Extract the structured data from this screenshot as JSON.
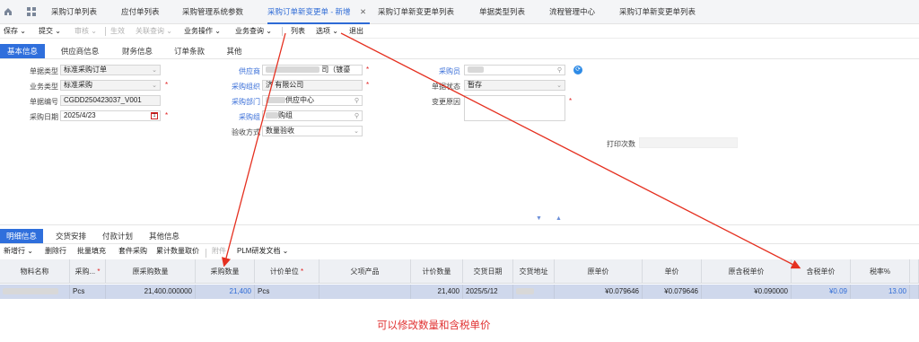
{
  "tabs": [
    {
      "label": "采购订单列表"
    },
    {
      "label": "应付单列表"
    },
    {
      "label": "采购管理系统参数"
    },
    {
      "label": "采购订单新变更单 - 新增"
    },
    {
      "label": "采购订单新变更单列表"
    },
    {
      "label": "单据类型列表"
    },
    {
      "label": "流程管理中心"
    },
    {
      "label": "采购订单新变更单列表"
    }
  ],
  "toolbar": {
    "save": "保存",
    "submit": "提交",
    "audit": "审核",
    "effect": "生效",
    "link_query": "关联查询",
    "biz_op": "业务操作",
    "biz_query": "业务查询",
    "list": "列表",
    "options": "选项",
    "exit": "退出"
  },
  "section_tabs": [
    "基本信息",
    "供应商信息",
    "财务信息",
    "订单条款",
    "其他"
  ],
  "form": {
    "doc_type": {
      "label": "单据类型",
      "value": "标准采购订单"
    },
    "biz_type": {
      "label": "业务类型",
      "value": "标准采购"
    },
    "doc_no": {
      "label": "单据编号",
      "value": "CGDD250423037_V001"
    },
    "purchase_date": {
      "label": "采购日期",
      "value": "2025/4/23"
    },
    "supplier": {
      "label": "供应商",
      "value": "司（镀鎏"
    },
    "purchase_org": {
      "label": "采购组织",
      "value": "济          有限公司"
    },
    "purchase_dept": {
      "label": "采购部门",
      "value": "供应中心"
    },
    "purchase_group": {
      "label": "采购组",
      "value": "购组"
    },
    "inspect": {
      "label": "验收方式",
      "value": "数量验收"
    },
    "buyer": {
      "label": "采购员",
      "value": ""
    },
    "doc_status": {
      "label": "单据状态",
      "value": "暂存"
    },
    "change_reason": {
      "label": "变更原因",
      "value": ""
    },
    "print_count": {
      "label": "打印次数",
      "value": ""
    }
  },
  "detail_tabs": [
    "明细信息",
    "交货安排",
    "付款计划",
    "其他信息"
  ],
  "detail_toolbar": [
    "新增行",
    "删除行",
    "批量填充",
    "套件采购",
    "累计数量取价",
    "附件",
    "PLM研发文档"
  ],
  "grid": {
    "headers": [
      "物料名称",
      "采购...",
      "原采购数量",
      "采购数量",
      "计价单位",
      "父项产品",
      "计价数量",
      "交货日期",
      "交货地址",
      "原单价",
      "单价",
      "原含税单价",
      "含税单价",
      "税率%"
    ],
    "row": [
      "",
      "Pcs",
      "21,400.000000",
      "21,400",
      "Pcs",
      "",
      "21,400",
      "2025/5/12",
      "",
      "¥0.079646",
      "¥0.079646",
      "¥0.090000",
      "¥0.09",
      "13.00"
    ]
  },
  "note": "可以修改数量和含税单价",
  "colors": {
    "accent": "#2e6bd6",
    "arrow": "#e53020"
  }
}
